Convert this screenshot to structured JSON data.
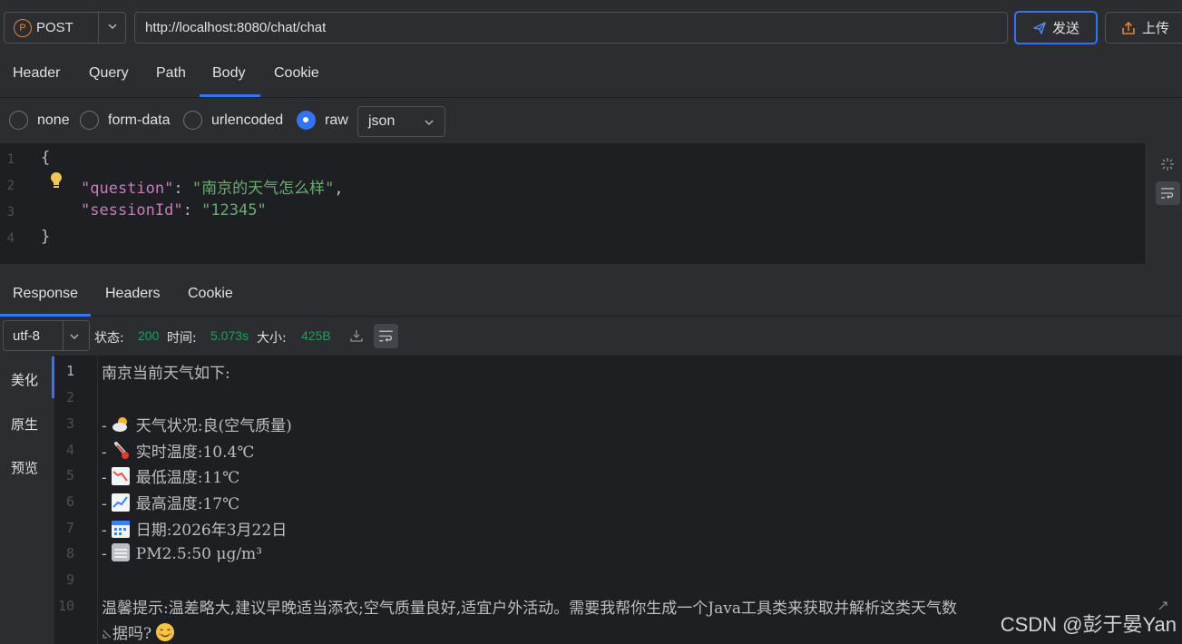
{
  "request": {
    "method": "POST",
    "method_badge": "P",
    "url": "http://localhost:8080/chat/chat",
    "send_label": "发送",
    "upload_label": "上传"
  },
  "request_tabs": [
    "Header",
    "Query",
    "Path",
    "Body",
    "Cookie"
  ],
  "active_request_tab": "Body",
  "body_types": [
    "none",
    "form-data",
    "urlencoded",
    "raw"
  ],
  "selected_body_type": "raw",
  "raw_format": "json",
  "request_body": {
    "line_numbers": [
      "1",
      "2",
      "3",
      "4"
    ],
    "open_brace": "{",
    "close_brace": "}",
    "key1": "\"question\"",
    "value1": "\"南京的天气怎么样\"",
    "key2": "\"sessionId\"",
    "value2": "\"12345\""
  },
  "response_tabs": [
    "Response",
    "Headers",
    "Cookie"
  ],
  "active_response_tab": "Response",
  "response_meta": {
    "encoding": "utf-8",
    "status_label": "状态:",
    "status_value": "200",
    "time_label": "时间:",
    "time_value": "5.073s",
    "size_label": "大小:",
    "size_value": "425B"
  },
  "view_modes": [
    "美化",
    "原生",
    "预览"
  ],
  "active_view_mode": "美化",
  "response_lines": [
    {
      "n": "1",
      "text": "南京当前天气如下:"
    },
    {
      "n": "2",
      "text": ""
    },
    {
      "n": "3",
      "prefix": "-",
      "icon": "sun-behind-cloud-icon",
      "text": "天气状况:良(空气质量)"
    },
    {
      "n": "4",
      "prefix": "-",
      "icon": "thermometer-icon",
      "text": "实时温度:10.4℃"
    },
    {
      "n": "5",
      "prefix": "-",
      "icon": "chart-decreasing-icon",
      "text": "最低温度:11℃"
    },
    {
      "n": "6",
      "prefix": "-",
      "icon": "chart-increasing-icon",
      "text": "最高温度:17℃"
    },
    {
      "n": "7",
      "prefix": "-",
      "icon": "calendar-icon",
      "text": "日期:2026年3月22日"
    },
    {
      "n": "8",
      "prefix": "-",
      "icon": "fog-icon",
      "text": "PM2.5:50 μg/m³"
    },
    {
      "n": "9",
      "text": ""
    },
    {
      "n": "10",
      "text": "温馨提示:温差略大,建议早晚适当添衣;空气质量良好,适宜户外活动。需要我帮你生成一个Java工具类来获取并解析这类天气数"
    },
    {
      "n": "",
      "text": "据吗?"
    }
  ],
  "watermark": "CSDN @彭于晏Yan",
  "colors": {
    "accent": "#3574f0",
    "status_green": "#1aa25a",
    "method_orange": "#e8812f"
  }
}
